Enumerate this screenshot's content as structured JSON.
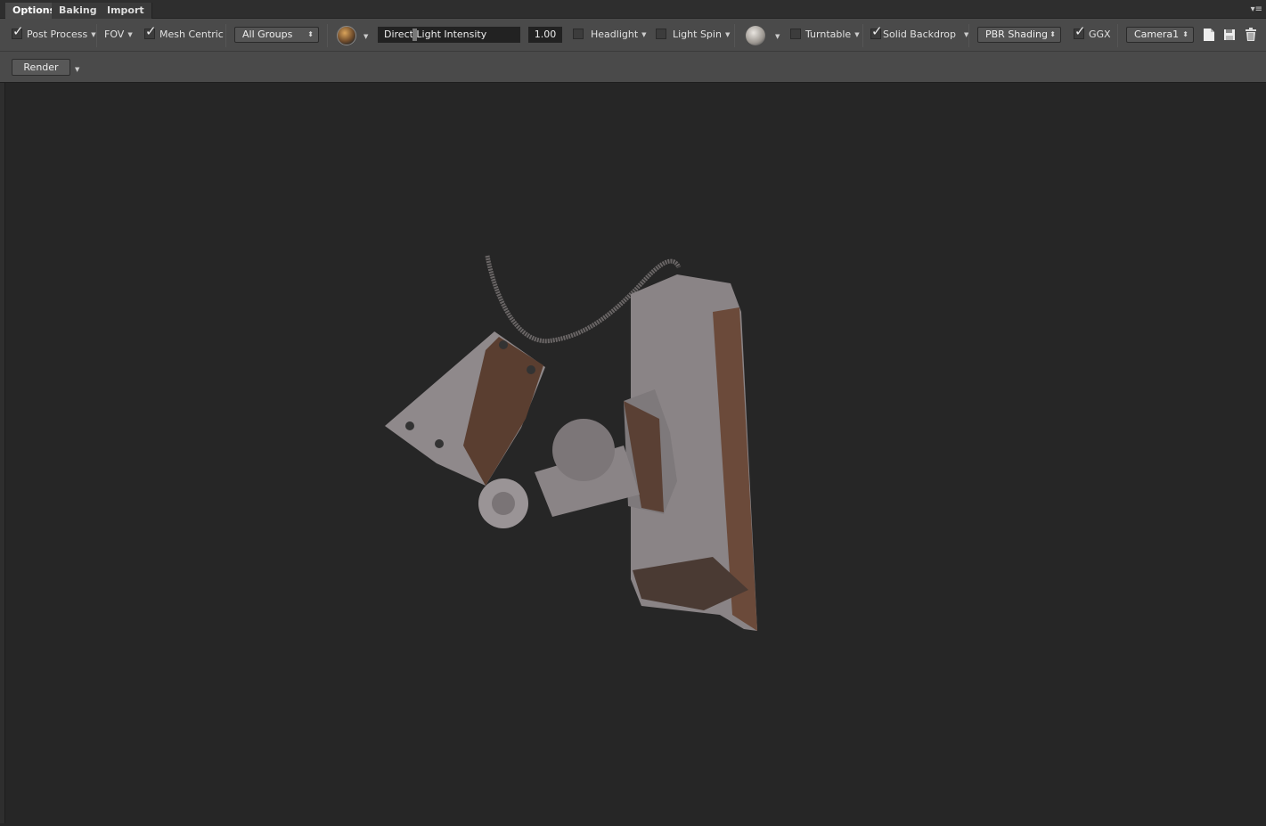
{
  "tabs": [
    {
      "label": "Options",
      "active": true
    },
    {
      "label": "Baking",
      "active": false
    },
    {
      "label": "Import",
      "active": false
    }
  ],
  "toolbar": {
    "post_process": {
      "label": "Post Process",
      "checked": true
    },
    "fov": "FOV",
    "mesh_centric": {
      "label": "Mesh Centric",
      "checked": true
    },
    "groups_select": "All Groups",
    "env_icon": "environment-sphere-icon",
    "light_slider_label": "Direct Light Intensity",
    "light_value": "1.00",
    "headlight": {
      "label": "Headlight",
      "checked": false
    },
    "light_spin": {
      "label": "Light Spin",
      "checked": false
    },
    "material_icon": "material-ball-icon",
    "turntable": {
      "label": "Turntable",
      "checked": false
    },
    "solid_backdrop": {
      "label": "Solid Backdrop",
      "checked": true
    },
    "shading_select": "PBR Shading",
    "ggx": {
      "label": "GGX",
      "checked": true
    },
    "camera_select": "Camera1"
  },
  "toolbar2": {
    "render_label": "Render"
  },
  "colors": {
    "viewport": "#262626",
    "toolbar": "#4a4a4a",
    "model": "#8a8486",
    "model_shadow": "#5a3e30"
  }
}
